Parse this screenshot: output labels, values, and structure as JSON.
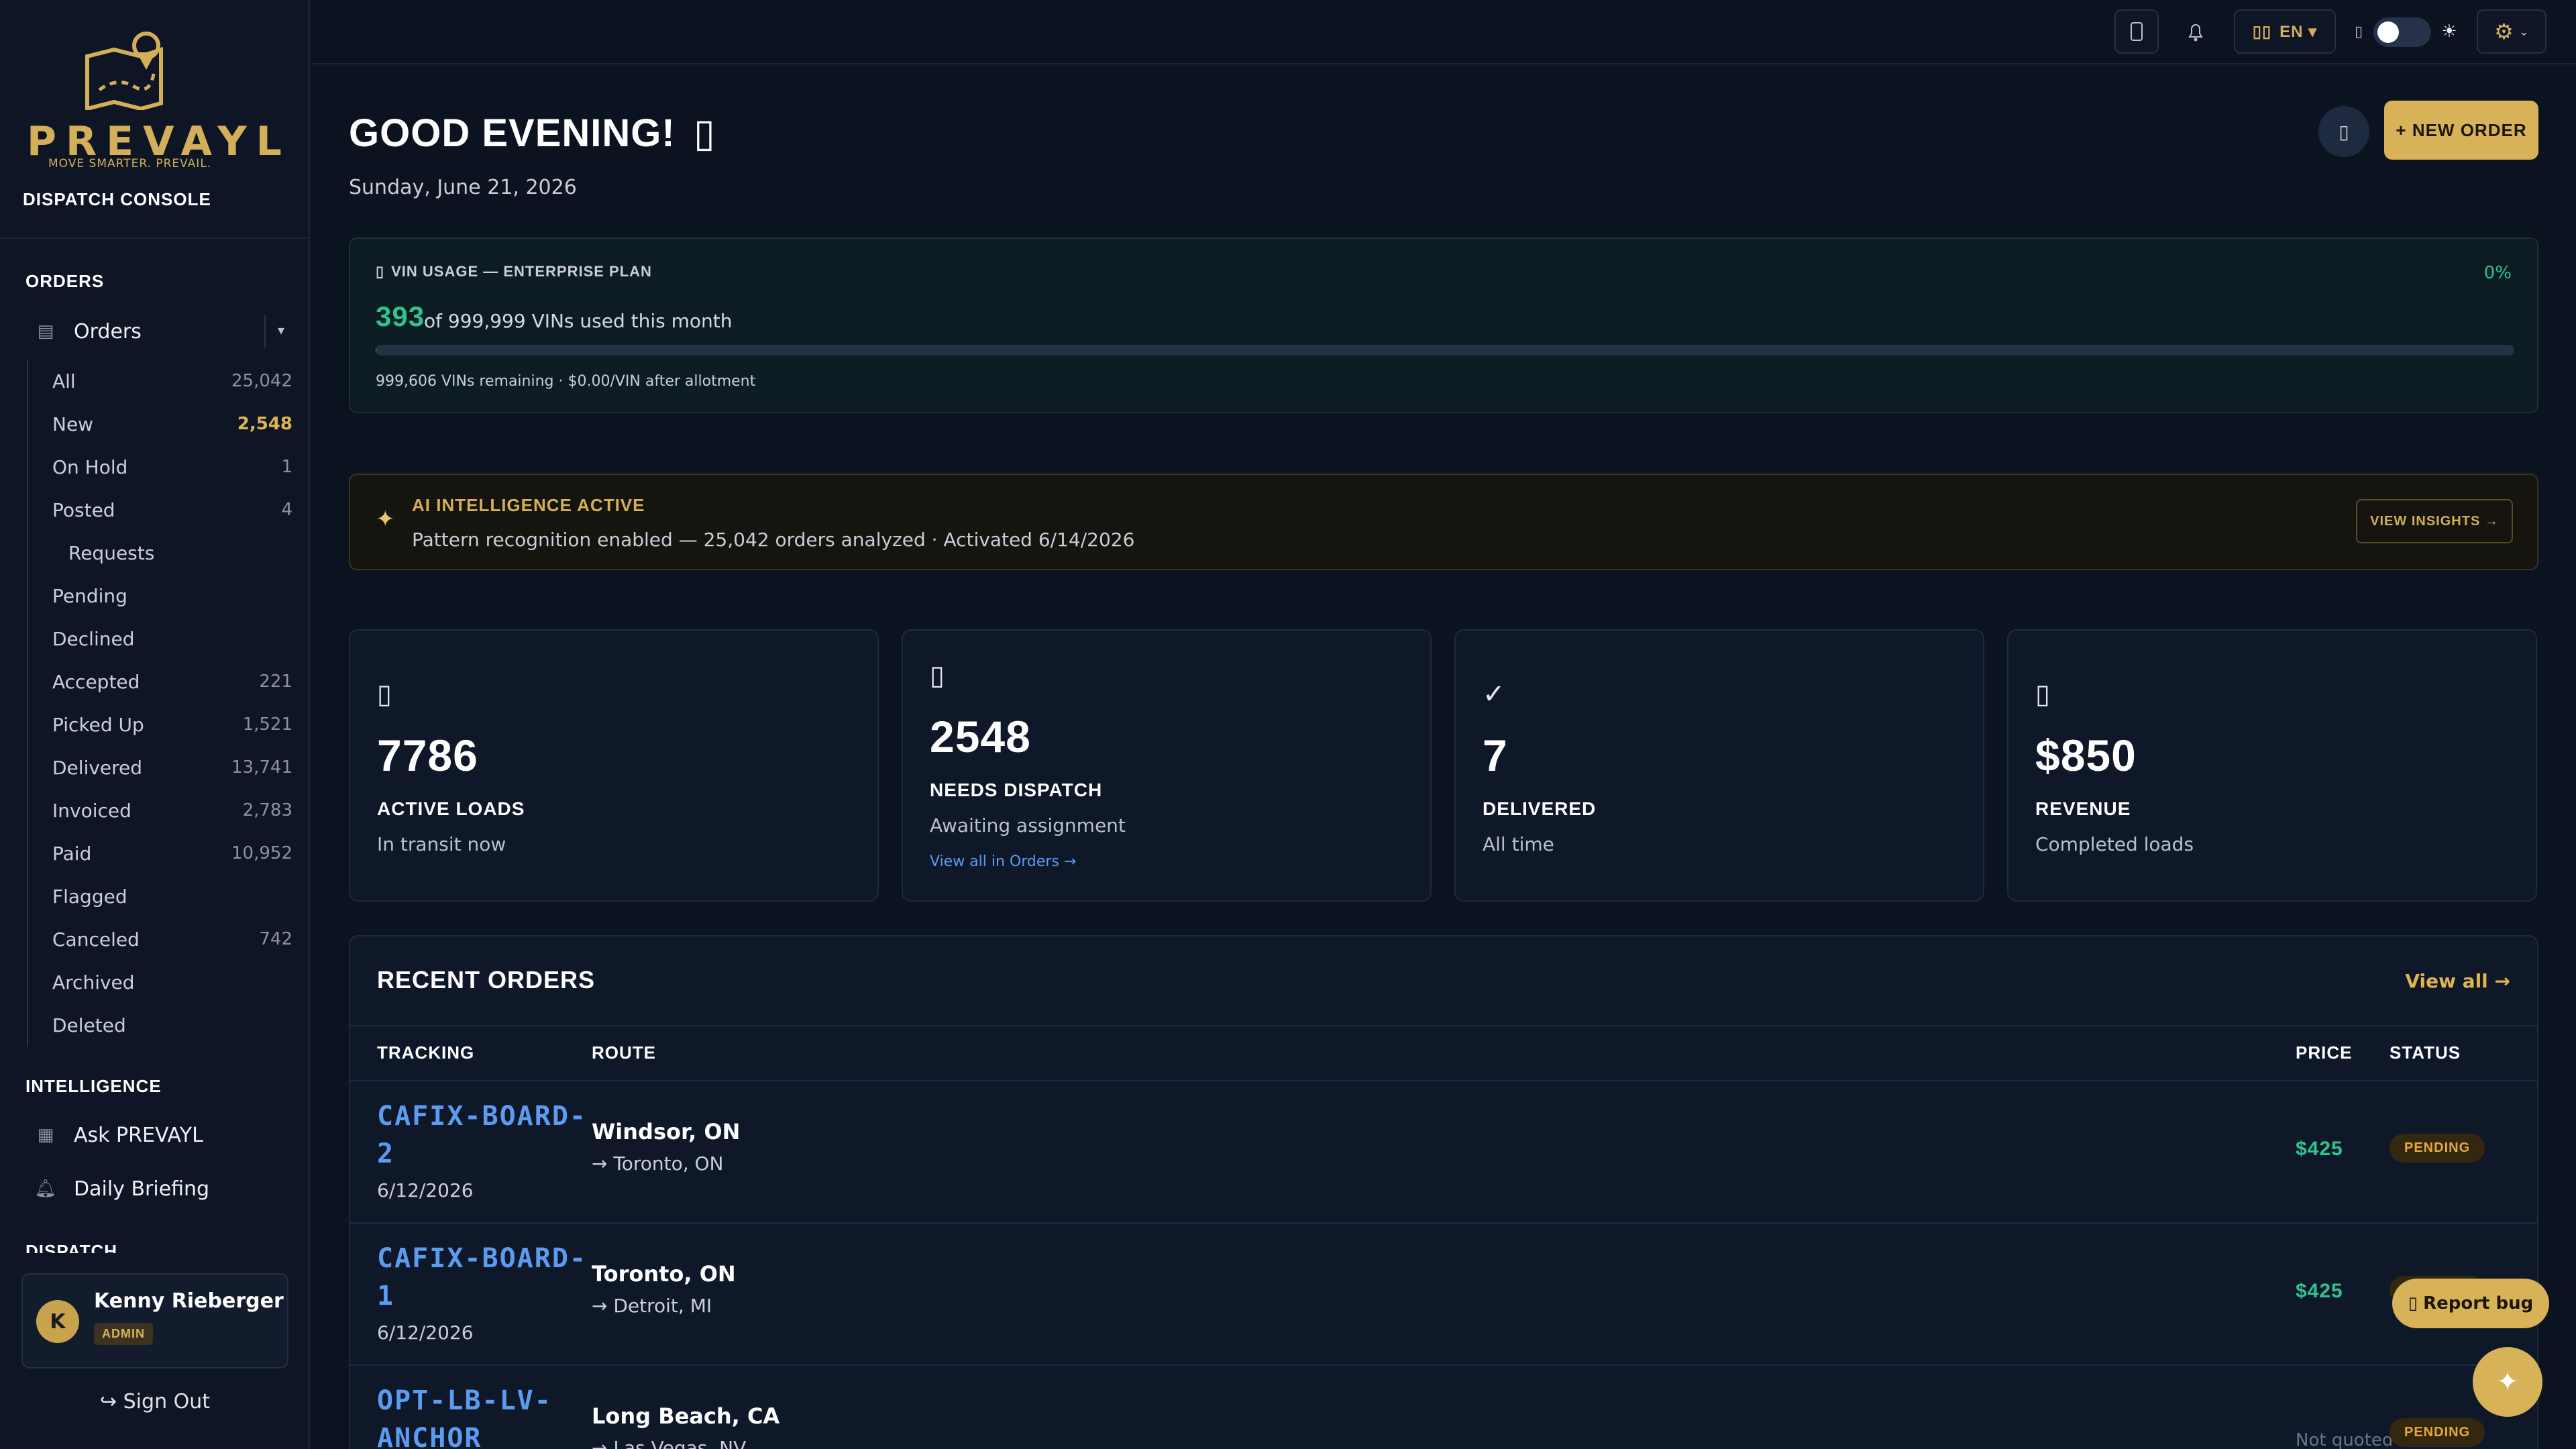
{
  "brand": {
    "name": "PREVAYL",
    "tagline": "MOVE SMARTER. PREVAIL.",
    "console": "DISPATCH CONSOLE",
    "gold": "#d4af5a"
  },
  "sidebar": {
    "orders_head": "ORDERS",
    "orders_label": "Orders",
    "orders_caret": "▾",
    "sub_items": [
      {
        "label": "All",
        "count": "25,042"
      },
      {
        "label": "New",
        "count": "2,548"
      },
      {
        "label": "On Hold",
        "count": "1"
      },
      {
        "label": "Posted",
        "count": "4"
      },
      {
        "label": "Requests",
        "count": ""
      },
      {
        "label": "Pending",
        "count": ""
      },
      {
        "label": "Declined",
        "count": ""
      },
      {
        "label": "Accepted",
        "count": "221"
      },
      {
        "label": "Picked Up",
        "count": "1,521"
      },
      {
        "label": "Delivered",
        "count": "13,741"
      },
      {
        "label": "Invoiced",
        "count": "2,783"
      },
      {
        "label": "Paid",
        "count": "10,952"
      },
      {
        "label": "Flagged",
        "count": ""
      },
      {
        "label": "Canceled",
        "count": "742"
      },
      {
        "label": "Archived",
        "count": ""
      },
      {
        "label": "Deleted",
        "count": ""
      }
    ],
    "intel_head": "INTELLIGENCE",
    "ask_label": "Ask PREVAYL",
    "briefing_label": "Daily Briefing",
    "dispatch_head": "DISPATCH",
    "user": {
      "initial": "K",
      "name": "Kenny Rieberger",
      "role": "ADMIN"
    },
    "signout": "↪ Sign Out"
  },
  "topbar": {
    "lang": "EN ▾",
    "theme_icon": "☀"
  },
  "main": {
    "greeting": "GOOD EVENING!",
    "date": "Sunday, June 21, 2026",
    "new_order": "+ NEW ORDER"
  },
  "vin": {
    "title": "VIN USAGE — ENTERPRISE PLAN",
    "percent": "0%",
    "percent_value": 0.04,
    "used": "393",
    "of_text": "of 999,999 VINs used this month",
    "note": "999,606 VINs remaining · $0.00/VIN after allotment"
  },
  "ai": {
    "title": "AI INTELLIGENCE ACTIVE",
    "text": "Pattern recognition enabled — 25,042 orders analyzed · Activated 6/14/2026",
    "button": "VIEW INSIGHTS →"
  },
  "stats": [
    {
      "icon": "truck-icon",
      "number": "7786",
      "label": "ACTIVE LOADS",
      "sub": "In transit now",
      "link": ""
    },
    {
      "icon": "inbox-icon",
      "number": "2548",
      "label": "NEEDS DISPATCH",
      "sub": "Awaiting assignment",
      "link": "View all in Orders →"
    },
    {
      "icon": "check-icon",
      "number": "7",
      "label": "DELIVERED",
      "sub": "All time",
      "link": ""
    },
    {
      "icon": "money-icon",
      "number": "$850",
      "label": "REVENUE",
      "sub": "Completed loads",
      "link": ""
    }
  ],
  "recent": {
    "title": "RECENT ORDERS",
    "view_all": "View all →",
    "columns": {
      "tracking": "TRACKING",
      "route": "ROUTE",
      "price": "PRICE",
      "status": "STATUS"
    },
    "rows": [
      {
        "tracking": "CAFIX-BOARD-2",
        "date": "6/12/2026",
        "from": "Windsor, ON",
        "to": "→ Toronto, ON",
        "price": "$425",
        "status": "PENDING"
      },
      {
        "tracking": "CAFIX-BOARD-1",
        "date": "6/12/2026",
        "from": "Toronto, ON",
        "to": "→ Detroit, MI",
        "price": "$425",
        "status": "PENDING"
      },
      {
        "tracking": "OPT-LB-LV-ANCHOR",
        "date": "",
        "from": "Long Beach, CA",
        "to": "→ Las Vegas, NV",
        "price": "Not quoted",
        "status": "PENDING"
      }
    ]
  },
  "report_bug": "Report bug",
  "fab_icon": "✦"
}
